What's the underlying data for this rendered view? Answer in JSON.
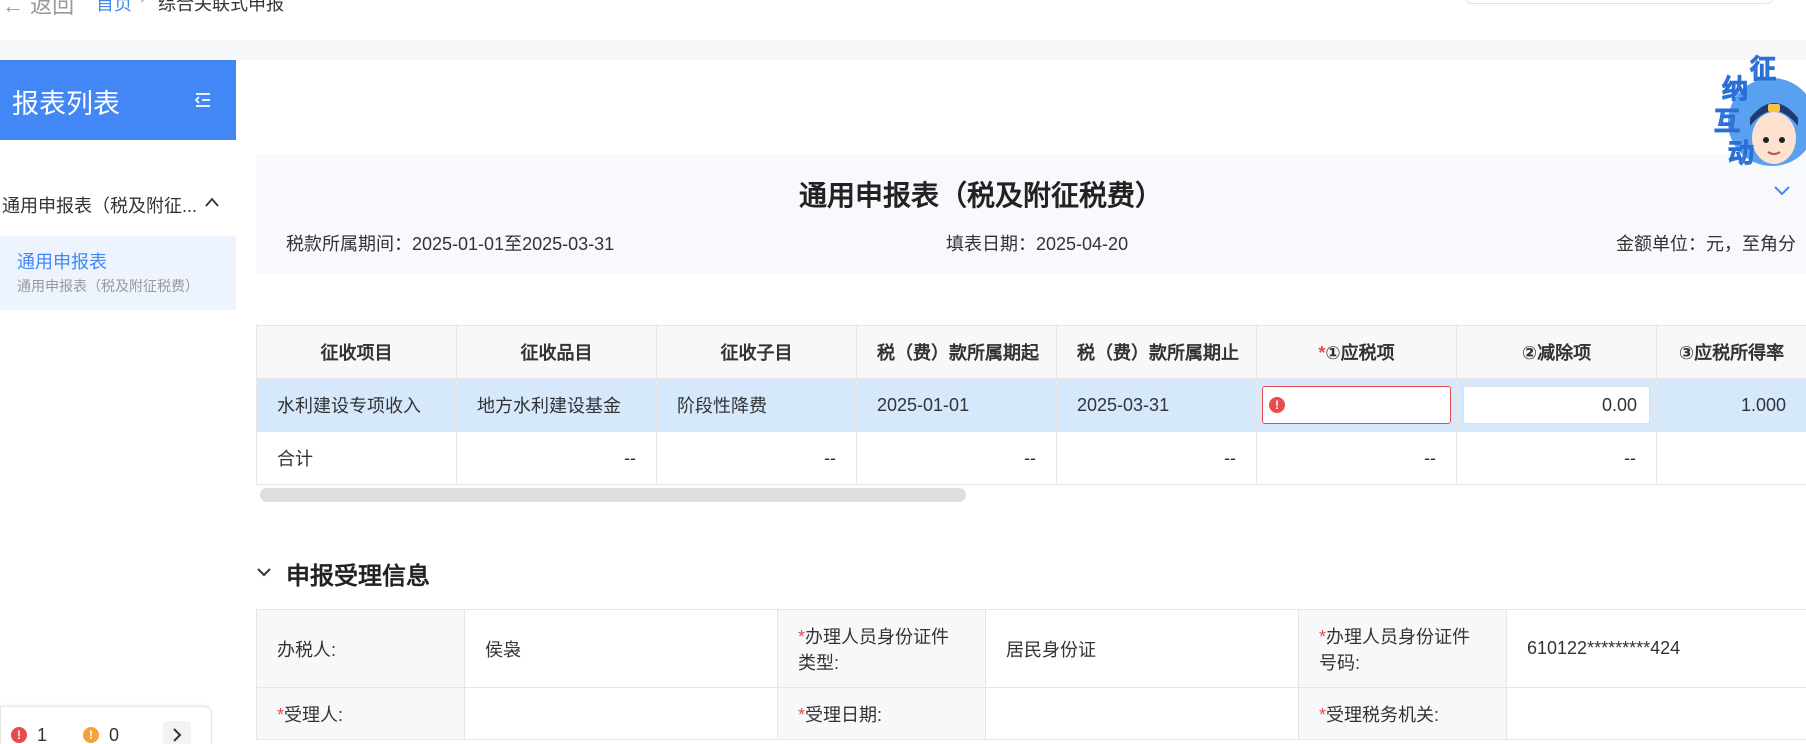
{
  "topbar": {
    "back_label": "← 返回",
    "crumb_home": "首页",
    "crumb_sep": "›",
    "crumb_current": "综合关联式申报"
  },
  "sidebar": {
    "title": "报表列表",
    "group_label": "通用申报表（税及附征...",
    "item_title": "通用申报表",
    "item_subtitle": "通用申报表（税及附征税费）"
  },
  "errors": {
    "error_count": "1",
    "warning_count": "0"
  },
  "form_header": {
    "title": "通用申报表（税及附征税费）",
    "period": "税款所属期间：2025-01-01至2025-03-31",
    "fill_date": "填表日期：2025-04-20",
    "unit": "金额单位：元，至角分"
  },
  "grid": {
    "columns": [
      "征收项目",
      "征收品目",
      "征收子目",
      "税（费）款所属期起",
      "税（费）款所属期止",
      "①应税项",
      "②减除项",
      "③应税所得率"
    ],
    "required_mark": "*",
    "row": {
      "item": "水利建设专项收入",
      "category": "地方水利建设基金",
      "sub": "阶段性降费",
      "start": "2025-01-01",
      "end": "2025-03-31",
      "taxable": "",
      "deduction": "0.00",
      "rate": "1.000"
    },
    "total": {
      "label": "合计",
      "c2": "--",
      "c3": "--",
      "c4": "--",
      "c5": "--",
      "c6": "--",
      "c7": "--"
    }
  },
  "acceptance": {
    "section_title": "申报受理信息",
    "required_mark": "*",
    "agent_label": "办税人:",
    "agent_value": "侯袅",
    "id_type_label": "办理人员身份证件类型:",
    "id_type_value": "居民身份证",
    "id_no_label": "办理人员身份证件号码:",
    "id_no_value": "610122*********424",
    "receiver_label": "受理人:",
    "receiver_value": "",
    "date_label": "受理日期:",
    "date_value": "",
    "office_label": "受理税务机关:",
    "office_value": ""
  },
  "mascot": {
    "chars": [
      "征",
      "纳",
      "互",
      "动"
    ]
  },
  "colors": {
    "primary": "#4386f5",
    "error": "#e84b4b",
    "selected_row": "#d6e8fc"
  }
}
